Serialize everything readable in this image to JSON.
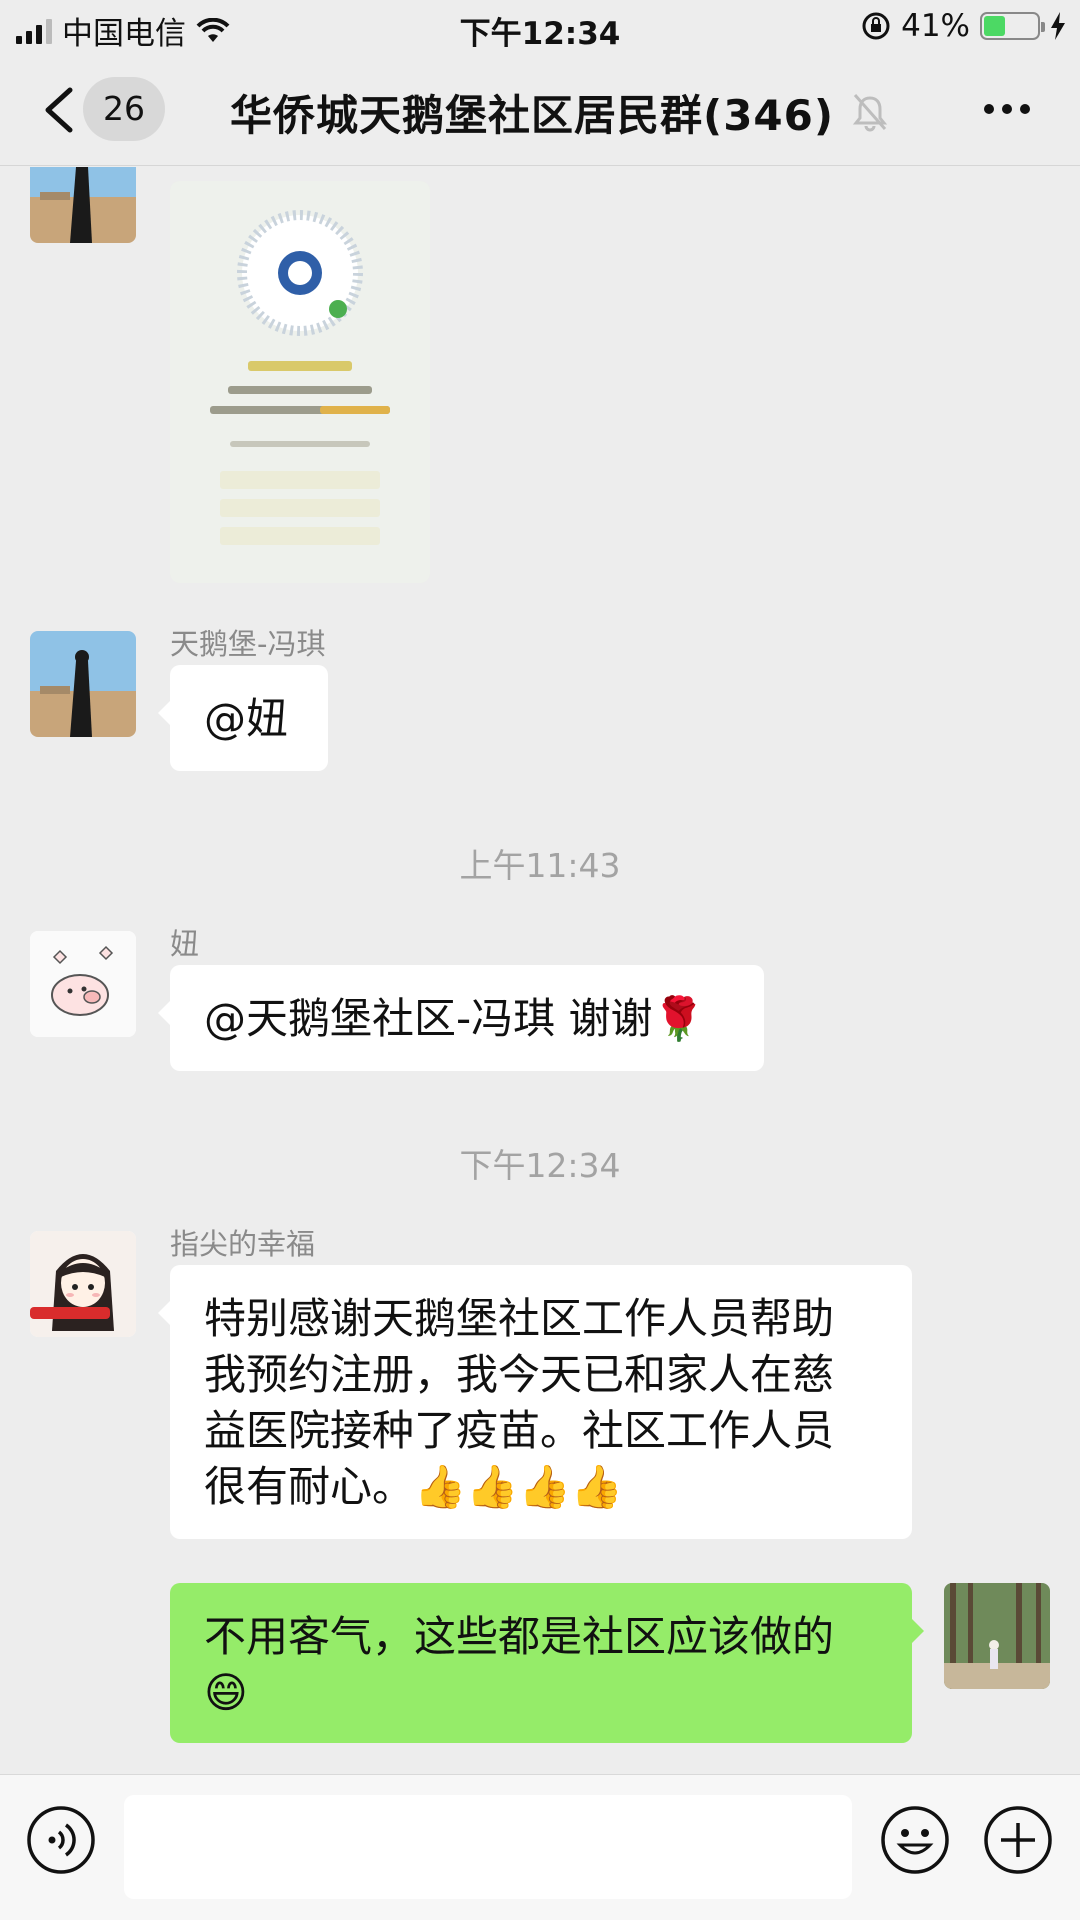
{
  "status_bar": {
    "carrier": "中国电信",
    "time": "下午12:34",
    "battery_percent": "41%",
    "battery_level": 0.41
  },
  "header": {
    "unread_count": "26",
    "title": "华侨城天鹅堡社区居民群(346)",
    "icons": [
      "chevron-left-icon",
      "bell-muted-icon",
      "more-icon"
    ]
  },
  "messages": [
    {
      "type": "image",
      "side": "left",
      "sender": "",
      "description_icon": "qr-code-image"
    },
    {
      "type": "text",
      "side": "left",
      "sender": "天鹅堡-冯琪",
      "text": "@妞"
    },
    {
      "type": "time",
      "text": "上午11:43"
    },
    {
      "type": "text",
      "side": "left",
      "sender": "妞",
      "text": "@天鹅堡社区-冯琪 谢谢🌹"
    },
    {
      "type": "time",
      "text": "下午12:34"
    },
    {
      "type": "text",
      "side": "left",
      "sender": "指尖的幸福",
      "lines": [
        "特别感谢天鹅堡社区工作人员帮助",
        "我预约注册，我今天已和家人在慈",
        "益医院接种了疫苗。社区工作人员",
        "很有耐心。👍👍👍👍"
      ]
    },
    {
      "type": "text",
      "side": "right",
      "sender": "",
      "lines": [
        "不用客气，这些都是社区应该做的",
        "😄"
      ]
    }
  ],
  "input_bar": {
    "icons": [
      "voice-icon",
      "emoji-icon",
      "plus-icon"
    ],
    "placeholder": ""
  },
  "colors": {
    "background": "#ededed",
    "own_bubble": "#95ec69",
    "other_bubble": "#ffffff",
    "battery": "#4cd964"
  }
}
